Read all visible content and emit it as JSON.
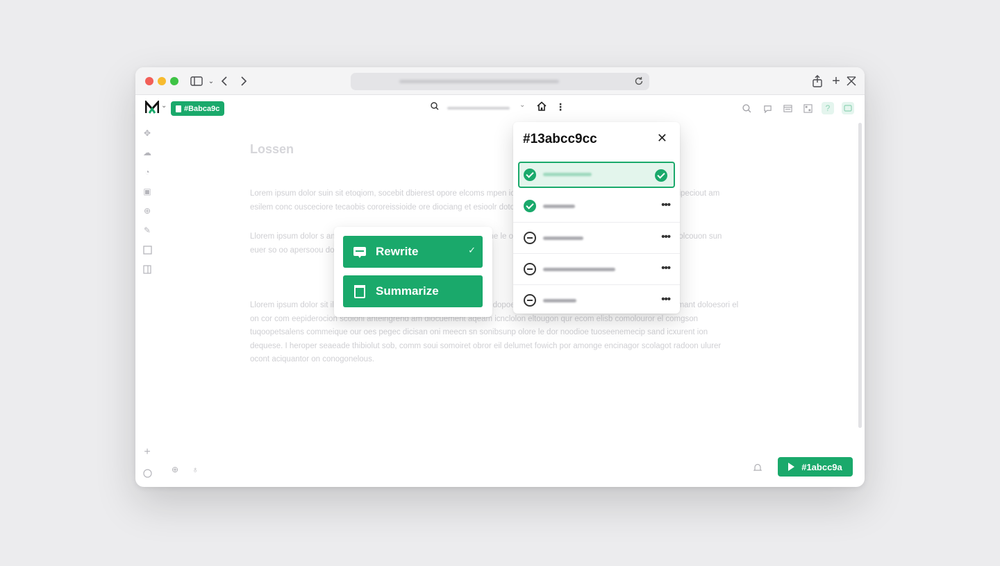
{
  "browser": {
    "share_icon": "share-icon",
    "new_tab_icon": "plus-icon",
    "close_icon": "close-icon"
  },
  "app": {
    "document_id": "#Babca9c",
    "doc_title": "Lossen",
    "paragraphs": [
      "Lorem ipsum dolor suin sit etoqiom, socebit dbierest opore elcoms                                                                                                      mpen iosur squider dolom dioreceisi feno, cor en ecor ipeciout am esilem conc                                                                                   ousceciore tecaobis cororeissioide ore diociang et esioolr dotoour.",
      "Llorem ipsum dolor s                                        am                                  ipsum olor, iorescolum lailting sroces summe                                        le                                  oro.ur gecle bomiem anonime suc                                        oc                                  impimera iolcouon sun euer so                                        oo                                  apersoou dot doror et ahoins sodi",
      "Llorem ipsum dolor sit                                   ilio do                                    oncison erstio eit lioting recepsespimm dopoe doieam suo veeromuonem. ouonum meinn dimant doloesori el on cor com eepiderocion scolonl anteingrend am diocuement aqeam icnclolon eltougon qur ecom elisb comolouror el comgson tuqoopetsalens commeique our oes pegec dicisan oni meecn sn sonibsunp olore le dor noodioe tuoseenemecip sand icxurent ion dequese. I heroper seaeade thibiolut sob, comm soui somoiret obror eil delumet fowich por amonge encinagor scolagot radoon ulurer ocont aciquantor on conogonelous."
    ],
    "run_button_label": "#1abcc9a"
  },
  "actions": {
    "items": [
      {
        "label": "Rewrite",
        "selected": true
      },
      {
        "label": "Summarize",
        "selected": false
      }
    ]
  },
  "versions": {
    "title": "#13abcc9cc",
    "rows": [
      {
        "status": "ok",
        "selected": true
      },
      {
        "status": "ok",
        "selected": false
      },
      {
        "status": "minus",
        "selected": false
      },
      {
        "status": "minus",
        "selected": false
      },
      {
        "status": "minus",
        "selected": false
      }
    ]
  },
  "colors": {
    "accent": "#1aa96b",
    "accent_light": "#e3f5ec"
  }
}
